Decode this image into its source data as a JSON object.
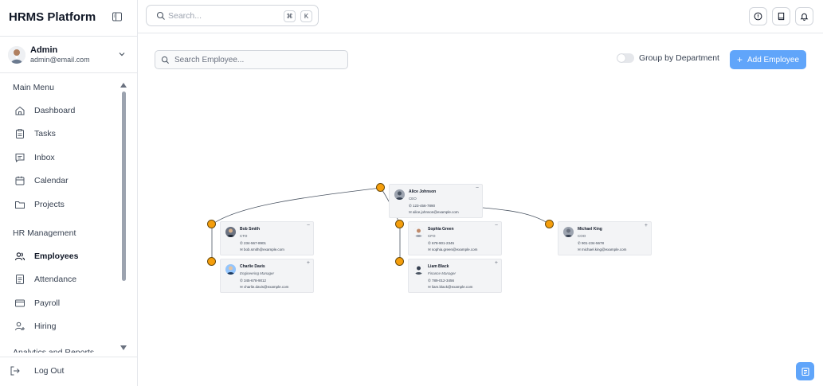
{
  "sidebar": {
    "brand": "HRMS Platform",
    "user": {
      "name": "Admin",
      "email": "admin@email.com"
    },
    "main_menu_label": "Main Menu",
    "main_menu": [
      {
        "label": "Dashboard",
        "icon": "home-icon"
      },
      {
        "label": "Tasks",
        "icon": "clipboard-icon"
      },
      {
        "label": "Inbox",
        "icon": "message-icon"
      },
      {
        "label": "Calendar",
        "icon": "calendar-icon"
      },
      {
        "label": "Projects",
        "icon": "folder-icon"
      }
    ],
    "hr_label": "HR Management",
    "hr_menu": [
      {
        "label": "Employees",
        "icon": "users-icon",
        "active": true
      },
      {
        "label": "Attendance",
        "icon": "document-icon"
      },
      {
        "label": "Payroll",
        "icon": "credit-card-icon"
      },
      {
        "label": "Hiring",
        "icon": "user-plus-icon"
      }
    ],
    "clipped_section_label": "Analytics and Reports",
    "logout_label": "Log Out"
  },
  "topbar": {
    "search_placeholder": "Search...",
    "shortcut_keys": [
      "⌘",
      "K"
    ],
    "buttons": [
      "info-icon",
      "book-icon",
      "bell-icon"
    ]
  },
  "toolbar": {
    "employee_search_placeholder": "Search Employee...",
    "group_toggle_label": "Group by Department",
    "group_toggle_on": false,
    "add_button_label": "Add Employee"
  },
  "colors": {
    "accent": "#60a5fa",
    "handle": "#f59e0b"
  },
  "org_chart": {
    "ceo": {
      "name": "Alice Johnson",
      "role": "CEO",
      "phone": "123-456-7890",
      "email": "alice.johnson@example.com",
      "toggle": "−"
    },
    "cto": {
      "name": "Bob Smith",
      "role": "CTO",
      "phone": "234-567-8901",
      "email": "bob.smith@example.com",
      "toggle": "−"
    },
    "eng": {
      "name": "Charlie Davis",
      "role": "Engineering Manager",
      "phone": "345-678-9012",
      "email": "charlie.davis@example.com",
      "toggle": "+"
    },
    "cfo": {
      "name": "Sophia Green",
      "role": "CFO",
      "phone": "678-901-2345",
      "email": "sophia.green@example.com",
      "toggle": "−"
    },
    "fin": {
      "name": "Liam Black",
      "role": "Finance Manager",
      "phone": "789-012-3456",
      "email": "liam.black@example.com",
      "toggle": "+"
    },
    "coo": {
      "name": "Michael King",
      "role": "COO",
      "phone": "901-234-5678",
      "email": "michael.king@example.com",
      "toggle": "+"
    }
  }
}
